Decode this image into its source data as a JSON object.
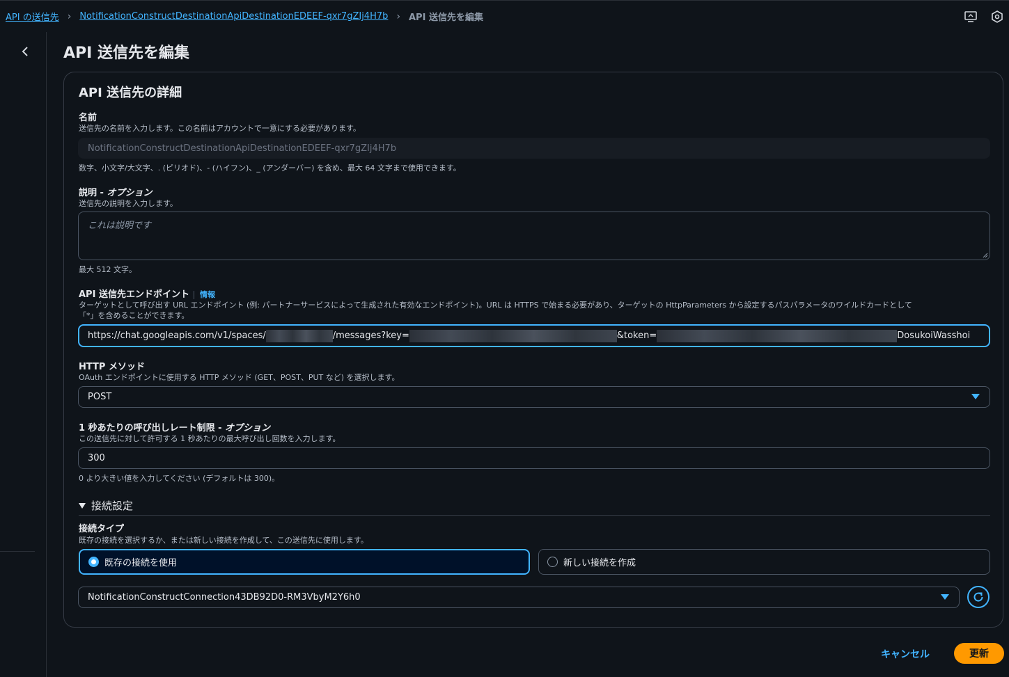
{
  "breadcrumb": {
    "items": [
      "API の送信先",
      "NotificationConstructDestinationApiDestinationEDEEF-qxr7gZIj4H7b"
    ],
    "current": "API 送信先を編集"
  },
  "page_title": "API 送信先を編集",
  "card_title": "API 送信先の詳細",
  "name_field": {
    "label": "名前",
    "description": "送信先の名前を入力します。この名前はアカウントで一意にする必要があります。",
    "value": "NotificationConstructDestinationApiDestinationEDEEF-qxr7gZIj4H7b",
    "constraint": "数字、小文字/大文字、. (ピリオド)、- (ハイフン)、_ (アンダーバー) を含め、最大 64 文字まで使用できます。"
  },
  "description_field": {
    "label": "説明 - ",
    "label_optional": "オプション",
    "description": "送信先の説明を入力します。",
    "placeholder": "これは説明です",
    "constraint": "最大 512 文字。"
  },
  "endpoint_field": {
    "label": "API 送信先エンドポイント",
    "info": "情報",
    "description_line1": "ターゲットとして呼び出す URL エンドポイント (例: パートナーサービスによって生成された有効なエンドポイント)。URL は HTTPS で始まる必要があり、ターゲットの HttpParameters から設定するパスパラメータのワイルドカードとして",
    "description_line2": "「*」を含めることができます。",
    "value_part1": "https://chat.googleapis.com/v1/spaces/",
    "value_part2": "/messages?key=",
    "value_part3": "&token=",
    "value_part4": "DosukoiWasshoi"
  },
  "http_method": {
    "label": "HTTP メソッド",
    "description": "OAuth エンドポイントに使用する HTTP メソッド (GET、POST、PUT など) を選択します。",
    "selected": "POST"
  },
  "rate_limit": {
    "label": "1 秒あたりの呼び出しレート制限 - ",
    "label_optional": "オプション",
    "description": "この送信先に対して許可する 1 秒あたりの最大呼び出し回数を入力します。",
    "value": "300",
    "constraint": "0 より大きい値を入力してください (デフォルトは 300)。"
  },
  "connection_section": {
    "title": "接続設定",
    "type_label": "接続タイプ",
    "type_description": "既存の接続を選択するか、または新しい接続を作成して、この送信先に使用します。",
    "option_existing": "既存の接続を使用",
    "option_new": "新しい接続を作成",
    "selected_option": "既存の接続を使用",
    "selected_connection": "NotificationConstructConnection43DB92D0-RM3VbyM2Y6h0"
  },
  "actions": {
    "cancel": "キャンセル",
    "update": "更新"
  },
  "colors": {
    "background": "#0f141a",
    "accent": "#42b4ff",
    "primary_button": "#ff9900"
  },
  "icons": [
    "chevron-right-icon",
    "screen-icon",
    "settings-hexagon-icon",
    "chevron-left-icon",
    "caret-down-icon",
    "refresh-icon"
  ]
}
